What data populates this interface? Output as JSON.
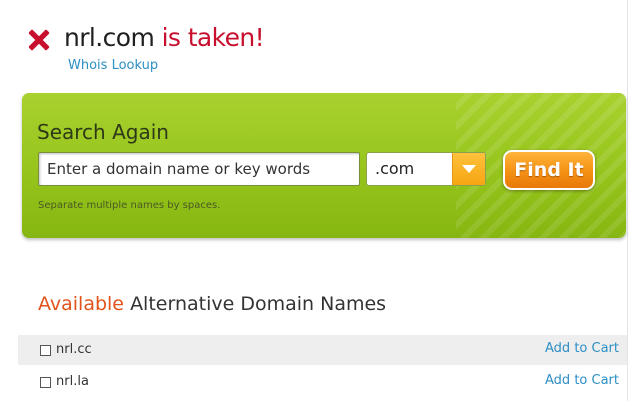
{
  "header": {
    "domain": "nrl.com",
    "status": "is taken!",
    "whois_link": "Whois Lookup"
  },
  "search": {
    "heading": "Search Again",
    "placeholder": "Enter a domain name or key words",
    "tld_selected": ".com",
    "button_label": "Find It",
    "hint": "Separate multiple names by spaces."
  },
  "alternatives": {
    "heading_highlight": "Available",
    "heading_rest": "Alternative Domain Names",
    "items": [
      {
        "name": "nrl.cc",
        "action": "Add to Cart"
      },
      {
        "name": "nrl.la",
        "action": "Add to Cart"
      }
    ]
  },
  "colors": {
    "taken_red": "#c8102e",
    "link_blue": "#2d8fc4",
    "panel_green": "#96c41c",
    "button_orange": "#f59315",
    "available_orange": "#e2531c"
  },
  "icons": {
    "status": "x-icon",
    "dropdown": "chevron-down-icon"
  }
}
